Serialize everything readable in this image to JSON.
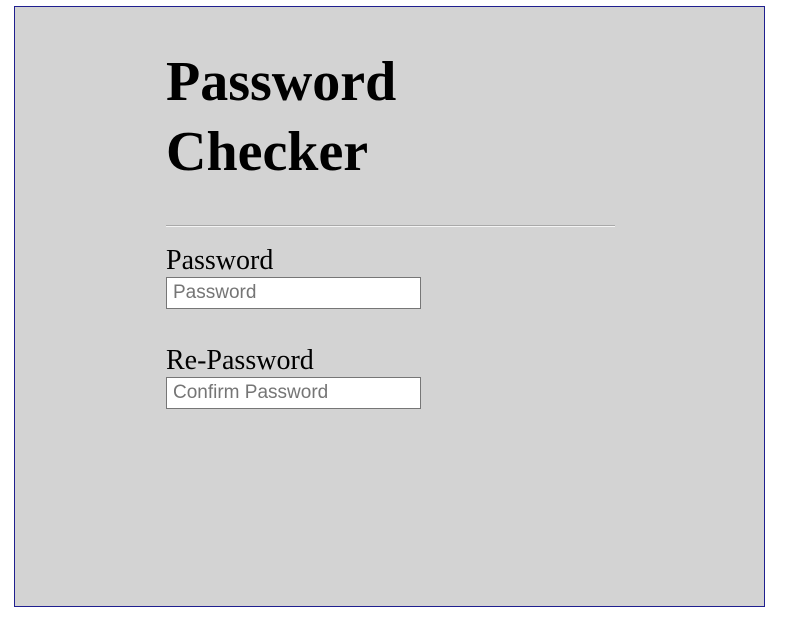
{
  "page": {
    "title": "Password Checker"
  },
  "form": {
    "password": {
      "label": "Password",
      "placeholder": "Password",
      "value": ""
    },
    "repassword": {
      "label": "Re-Password",
      "placeholder": "Confirm Password",
      "value": ""
    }
  },
  "colors": {
    "panel_background": "#d3d3d3",
    "panel_border": "#1f1f8f",
    "text": "#000000"
  }
}
